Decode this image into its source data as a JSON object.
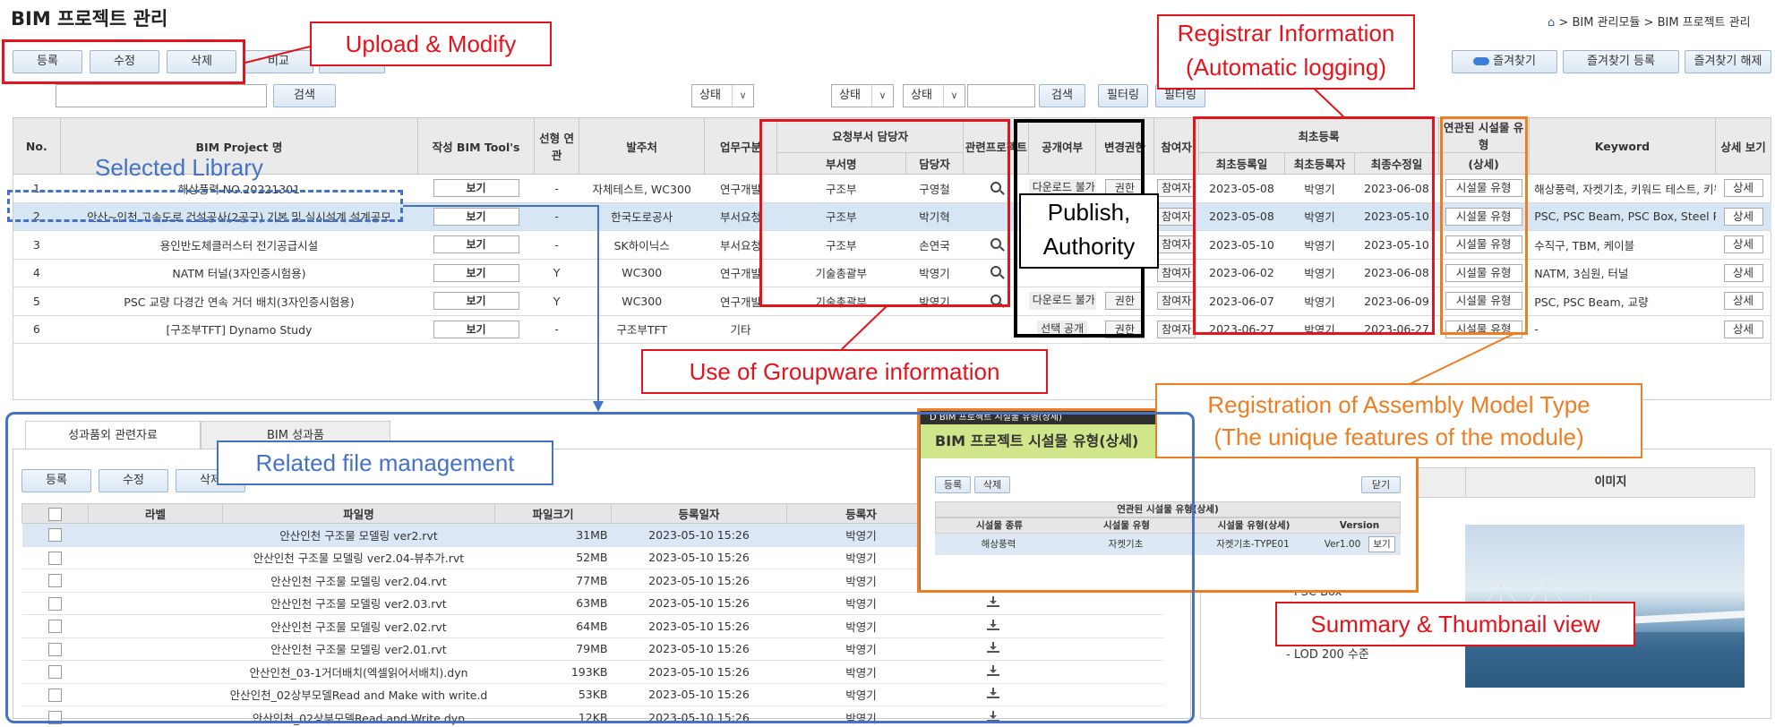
{
  "page_title": "BIM 프로젝트 관리",
  "breadcrumb": {
    "level1": "BIM 관리모듈",
    "level2": "BIM 프로젝트 관리"
  },
  "toolbar": {
    "register": "등록",
    "modify": "수정",
    "delete": "삭제",
    "compare": "비교"
  },
  "favorites": {
    "toggle": "즐겨찾기",
    "register": "즐겨찾기 등록",
    "release": "즐겨찾기 해제"
  },
  "search": {
    "button": "검색",
    "button2": "검색",
    "status1": "상태",
    "status2": "상태",
    "status3": "상태",
    "filter1": "필터링",
    "filter2": "필터링"
  },
  "table": {
    "headers": {
      "no": "No.",
      "project": "BIM Project 명",
      "tool": "작성 BIM Tool's",
      "linked": "선형 연관",
      "client": "발주처",
      "work": "업무구분",
      "dept_group": "요청부서 담당자",
      "dept": "부서명",
      "manager": "담당자",
      "related": "관련프로젝트",
      "public": "공개여부",
      "auth": "변경권한",
      "participant": "참여자",
      "reg_group": "최초등록",
      "reg_date": "최초등록일",
      "registrant": "최초등록자",
      "mod_date": "최종수정일",
      "facility_group": "연관된 시설물 유형",
      "facility_detail": "(상세)",
      "keyword": "Keyword",
      "detail": "상세 보기"
    },
    "rows": [
      {
        "no": "1",
        "project": "해상풍력 NO.20221301",
        "tool": "보기",
        "linked": "-",
        "client": "자체테스트, WC300",
        "work": "연구개발",
        "dept": "구조부",
        "manager": "구영철",
        "public": "다운로드 불가",
        "auth": "권한",
        "participant": "참여자",
        "reg_date": "2023-05-08",
        "registrant": "박영기",
        "mod_date": "2023-06-08",
        "facility": "시설물 유형",
        "keyword": "해상풍력, 자켓기초, 키워드 테스트, 키워",
        "detail": "상세"
      },
      {
        "no": "2",
        "project": "안산~인천 고속도로 건설공사(2공구) 기본 및 실시설계 설계공모",
        "tool": "보기",
        "linked": "-",
        "client": "한국도로공사",
        "work": "부서요청",
        "dept": "구조부",
        "manager": "박기혁",
        "public": "",
        "auth": "",
        "participant": "참여자",
        "reg_date": "2023-05-08",
        "registrant": "박영기",
        "mod_date": "2023-05-10",
        "facility": "시설물 유형",
        "keyword": "PSC, PSC Beam, PSC Box, Steel Plat",
        "detail": "상세"
      },
      {
        "no": "3",
        "project": "용인반도체클러스터 전기공급시설",
        "tool": "보기",
        "linked": "-",
        "client": "SK하이닉스",
        "work": "부서요청",
        "dept": "구조부",
        "manager": "손연국",
        "public": "",
        "auth": "",
        "participant": "참여자",
        "reg_date": "2023-05-10",
        "registrant": "박영기",
        "mod_date": "2023-05-10",
        "facility": "시설물 유형",
        "keyword": "수직구, TBM, 케이블",
        "detail": "상세"
      },
      {
        "no": "4",
        "project": "NATM 터널(3자인증시험용)",
        "tool": "보기",
        "linked": "Y",
        "client": "WC300",
        "work": "연구개발",
        "dept": "기술총괄부",
        "manager": "박영기",
        "public": "",
        "auth": "",
        "participant": "참여자",
        "reg_date": "2023-06-02",
        "registrant": "박영기",
        "mod_date": "2023-06-08",
        "facility": "시설물 유형",
        "keyword": "NATM, 3심원, 터널",
        "detail": "상세"
      },
      {
        "no": "5",
        "project": "PSC 교량 다경간 연속 거더 배치(3자인증시험용)",
        "tool": "보기",
        "linked": "Y",
        "client": "WC300",
        "work": "연구개발",
        "dept": "기술총괄부",
        "manager": "박영기",
        "public": "다운로드 불가",
        "auth": "권한",
        "participant": "참여자",
        "reg_date": "2023-06-07",
        "registrant": "박영기",
        "mod_date": "2023-06-09",
        "facility": "시설물 유형",
        "keyword": "PSC, PSC Beam, 교량",
        "detail": "상세"
      },
      {
        "no": "6",
        "project": "[구조부TFT] Dynamo Study",
        "tool": "보기",
        "linked": "-",
        "client": "구조부TFT",
        "work": "기타",
        "dept": "",
        "manager": "",
        "public": "선택 공개",
        "auth": "권한",
        "participant": "참여자",
        "reg_date": "2023-06-27",
        "registrant": "박영기",
        "mod_date": "2023-06-27",
        "facility": "시설물 유형",
        "keyword": "-",
        "detail": "상세"
      }
    ]
  },
  "lower_tabs": {
    "tab1": "성과품외 관련자료",
    "tab2": "BIM 성과품"
  },
  "lower_toolbar": {
    "register": "등록",
    "modify": "수정",
    "delete": "삭제"
  },
  "files": {
    "headers": {
      "label": "라벨",
      "name": "파일명",
      "size": "파일크기",
      "date": "등록일자",
      "user": "등록자"
    },
    "rows": [
      {
        "name": "안산인천 구조물 모델링 ver2.rvt",
        "size": "31MB",
        "date": "2023-05-10 15:26",
        "user": "박영기"
      },
      {
        "name": "안산인천 구조물 모델링 ver2.04-뷰추가.rvt",
        "size": "52MB",
        "date": "2023-05-10 15:26",
        "user": "박영기"
      },
      {
        "name": "안산인천 구조물 모델링 ver2.04.rvt",
        "size": "77MB",
        "date": "2023-05-10 15:26",
        "user": "박영기"
      },
      {
        "name": "안산인천 구조물 모델링 ver2.03.rvt",
        "size": "63MB",
        "date": "2023-05-10 15:26",
        "user": "박영기"
      },
      {
        "name": "안산인천 구조물 모델링 ver2.02.rvt",
        "size": "64MB",
        "date": "2023-05-10 15:26",
        "user": "박영기"
      },
      {
        "name": "안산인천 구조물 모델링 ver2.01.rvt",
        "size": "79MB",
        "date": "2023-05-10 15:26",
        "user": "박영기"
      },
      {
        "name": "안산인천_03-1거더배치(엑셀읽어서배치).dyn",
        "size": "193KB",
        "date": "2023-05-10 15:26",
        "user": "박영기"
      },
      {
        "name": "안산인천_02상부모델Read and Make with write.d",
        "size": "53KB",
        "date": "2023-05-10 15:26",
        "user": "박영기"
      },
      {
        "name": "안산인천_02상부모델Read and Write.dyn",
        "size": "12KB",
        "date": "2023-05-10 15:26",
        "user": "박영기"
      }
    ]
  },
  "popup": {
    "window_title": "BIM 프로젝트 시설물 유형(상세)",
    "title": "BIM 프로젝트 시설물 유형(상세)",
    "register": "등록",
    "delete": "삭제",
    "close": "닫기",
    "group_header": "연관된 시설물 유형(상세)",
    "headers": {
      "kind": "시설물 종류",
      "type": "시설물 유형",
      "detail": "시설물 유형(상세)",
      "version": "Version"
    },
    "row": {
      "kind": "해상풍력",
      "type": "자켓기초",
      "detail": "자켓기초-TYPE01",
      "version": "Ver1.00",
      "view": "보기"
    }
  },
  "summary": {
    "image_header": "이미지",
    "line1": "- PSC Box",
    "line2": "- LOD 200 수준"
  },
  "annotations": {
    "upload_modify": "Upload & Modify",
    "registrar1": "Registrar Information",
    "registrar2": "(Automatic logging)",
    "selected_library": "Selected Library",
    "publish": "Publish,",
    "authority": "Authority",
    "groupware": "Use of Groupware information",
    "assembly1": "Registration of Assembly Model Type",
    "assembly2": "(The unique features of the module)",
    "related_file": "Related file management",
    "summary_view": "Summary & Thumbnail view"
  },
  "colors": {
    "red": "#e3141c",
    "orange": "#ef7d22",
    "blue": "#4472c4",
    "black": "#000000",
    "selected_row": "#d6e6f5",
    "popup_header": "#cfe68a"
  }
}
